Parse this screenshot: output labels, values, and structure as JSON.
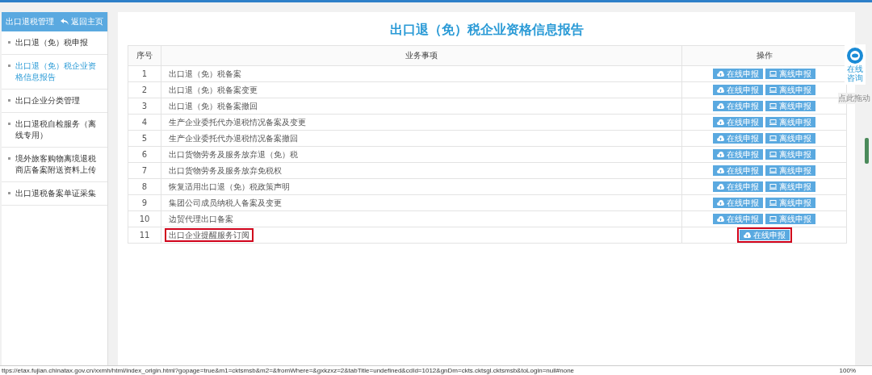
{
  "sidebar": {
    "title": "出口退税管理",
    "back_link": "返回主页",
    "items": [
      {
        "label": "出口退（免）税申报",
        "selected": false
      },
      {
        "label": "出口退（免）税企业资格信息报告",
        "selected": true
      },
      {
        "label": "出口企业分类管理",
        "selected": false
      },
      {
        "label": "出口退税自检服务（离线专用）",
        "selected": false
      },
      {
        "label": "境外旅客购物离境退税商店备案附送资料上传",
        "selected": false
      },
      {
        "label": "出口退税备案单证采集",
        "selected": false
      }
    ]
  },
  "page_title": "出口退（免）税企业资格信息报告",
  "table": {
    "columns": [
      "序号",
      "业务事项",
      "操作"
    ],
    "rows": [
      {
        "index": "1",
        "item": "出口退（免）税备案",
        "highlighted": false,
        "actions": [
          {
            "kind": "online",
            "label": "在线申报"
          },
          {
            "kind": "offline",
            "label": "离线申报"
          }
        ]
      },
      {
        "index": "2",
        "item": "出口退（免）税备案变更",
        "highlighted": false,
        "actions": [
          {
            "kind": "online",
            "label": "在线申报"
          },
          {
            "kind": "offline",
            "label": "离线申报"
          }
        ]
      },
      {
        "index": "3",
        "item": "出口退（免）税备案撤回",
        "highlighted": false,
        "actions": [
          {
            "kind": "online",
            "label": "在线申报"
          },
          {
            "kind": "offline",
            "label": "离线申报"
          }
        ]
      },
      {
        "index": "4",
        "item": "生产企业委托代办退税情况备案及变更",
        "highlighted": false,
        "actions": [
          {
            "kind": "online",
            "label": "在线申报"
          },
          {
            "kind": "offline",
            "label": "离线申报"
          }
        ]
      },
      {
        "index": "5",
        "item": "生产企业委托代办退税情况备案撤回",
        "highlighted": false,
        "actions": [
          {
            "kind": "online",
            "label": "在线申报"
          },
          {
            "kind": "offline",
            "label": "离线申报"
          }
        ]
      },
      {
        "index": "6",
        "item": "出口货物劳务及服务放弃退（免）税",
        "highlighted": false,
        "actions": [
          {
            "kind": "online",
            "label": "在线申报"
          },
          {
            "kind": "offline",
            "label": "离线申报"
          }
        ]
      },
      {
        "index": "7",
        "item": "出口货物劳务及服务放弃免税权",
        "highlighted": false,
        "actions": [
          {
            "kind": "online",
            "label": "在线申报"
          },
          {
            "kind": "offline",
            "label": "离线申报"
          }
        ]
      },
      {
        "index": "8",
        "item": "恢复适用出口退（免）税政策声明",
        "highlighted": false,
        "actions": [
          {
            "kind": "online",
            "label": "在线申报"
          },
          {
            "kind": "offline",
            "label": "离线申报"
          }
        ]
      },
      {
        "index": "9",
        "item": "集团公司成员纳税人备案及变更",
        "highlighted": false,
        "actions": [
          {
            "kind": "online",
            "label": "在线申报"
          },
          {
            "kind": "offline",
            "label": "离线申报"
          }
        ]
      },
      {
        "index": "10",
        "item": "边贸代理出口备案",
        "highlighted": false,
        "actions": [
          {
            "kind": "online",
            "label": "在线申报"
          },
          {
            "kind": "offline",
            "label": "离线申报"
          }
        ]
      },
      {
        "index": "11",
        "item": "出口企业提醒服务订阅",
        "highlighted": true,
        "actions": [
          {
            "kind": "online",
            "label": "在线申报"
          }
        ]
      }
    ]
  },
  "consult_widget": {
    "label": "在线咨询",
    "drag_hint": "点此拖动"
  },
  "status_bar": {
    "url": "ttps://etax.fujian.chinatax.gov.cn/xxmh/html/index_origin.html?gopage=true&m1=cktsmsb&m2=&fromWhere=&gxkzxz=2&tabTitle=undefined&cdId=1012&gnDm=ckts.cktsgl.cktsmsb&toLogin=null#none",
    "zoom": "100%"
  }
}
